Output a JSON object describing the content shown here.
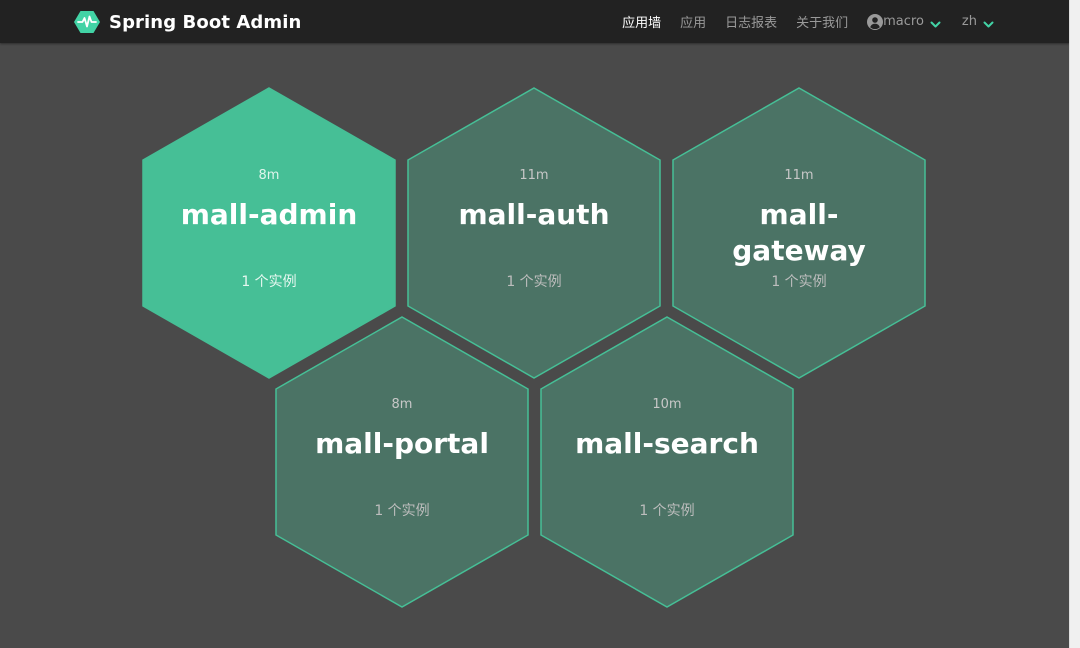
{
  "header": {
    "brand_title": "Spring Boot Admin",
    "nav": [
      {
        "label": "应用墙",
        "active": true
      },
      {
        "label": "应用",
        "active": false
      },
      {
        "label": "日志报表",
        "active": false
      },
      {
        "label": "关于我们",
        "active": false
      }
    ],
    "user": {
      "name": "macro"
    },
    "language": {
      "selected": "zh"
    }
  },
  "applications": [
    {
      "name": "mall-admin",
      "age": "8m",
      "instances": "1 个实例",
      "highlight": true
    },
    {
      "name": "mall-auth",
      "age": "11m",
      "instances": "1 个实例",
      "highlight": false
    },
    {
      "name": "mall-gateway",
      "age": "11m",
      "instances": "1 个实例",
      "highlight": false
    },
    {
      "name": "mall-portal",
      "age": "8m",
      "instances": "1 个实例",
      "highlight": false
    },
    {
      "name": "mall-search",
      "age": "10m",
      "instances": "1 个实例",
      "highlight": false
    }
  ],
  "colors": {
    "up_fill": "#46bf96",
    "tile_fill": "#4b7365",
    "tile_border": "#46bf96",
    "navbar": "#222222",
    "background": "#4a4a4a",
    "accent": "#42d3a5"
  }
}
